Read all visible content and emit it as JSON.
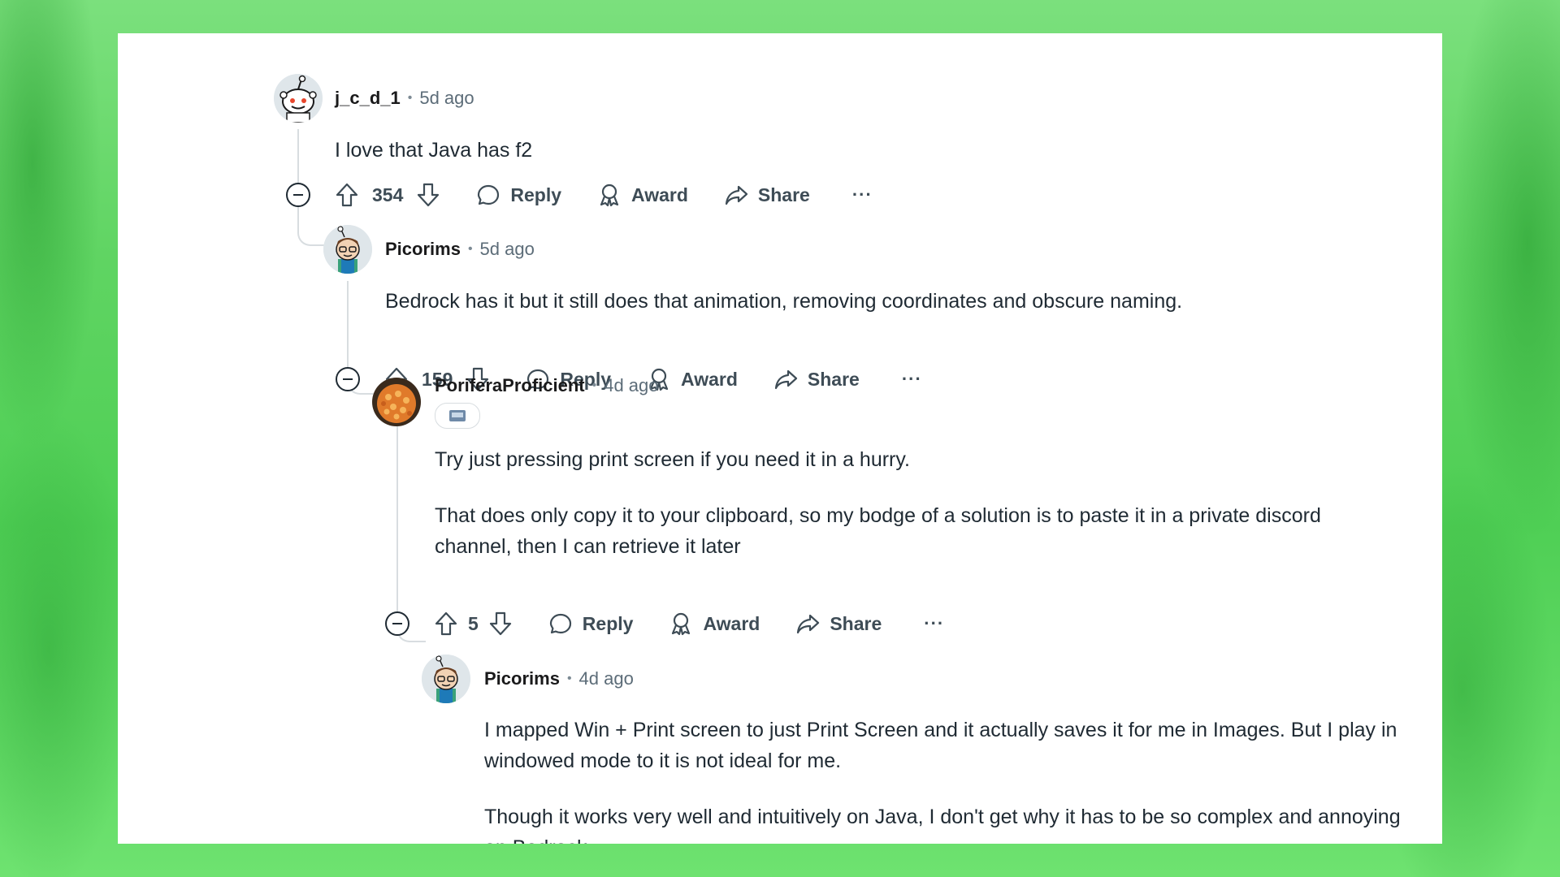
{
  "comments": [
    {
      "username": "j_c_d_1",
      "time": "5d ago",
      "paragraphs": [
        "I love that Java has f2"
      ],
      "score": "354",
      "actions": {
        "reply": "Reply",
        "award": "Award",
        "share": "Share",
        "more": "···"
      }
    },
    {
      "username": "Picorims",
      "time": "5d ago",
      "paragraphs": [
        "Bedrock has it but it still does that animation, removing coordinates and obscure naming."
      ],
      "score": "159",
      "actions": {
        "reply": "Reply",
        "award": "Award",
        "share": "Share",
        "more": "···"
      }
    },
    {
      "username": "PoriferaProficient",
      "time": "4d ago",
      "paragraphs": [
        "Try just pressing print screen if you need it in a hurry.",
        "That does only copy it to your clipboard, so my bodge of a solution is to paste it in a private discord channel, then I can retrieve it later"
      ],
      "score": "5",
      "actions": {
        "reply": "Reply",
        "award": "Award",
        "share": "Share",
        "more": "···"
      }
    },
    {
      "username": "Picorims",
      "time": "4d ago",
      "paragraphs": [
        "I mapped Win + Print screen to just Print Screen and it actually saves it for me in Images. But I play in windowed mode to it is not ideal for me.",
        "Though it works very well and intuitively on Java, I don't get why it has to be so complex and annoying on Bedrock."
      ]
    }
  ],
  "separator": "•",
  "colors": {
    "background": "#5fd462",
    "card": "#ffffff",
    "thread_line": "#d8dde0",
    "text": "#1f2a33"
  }
}
